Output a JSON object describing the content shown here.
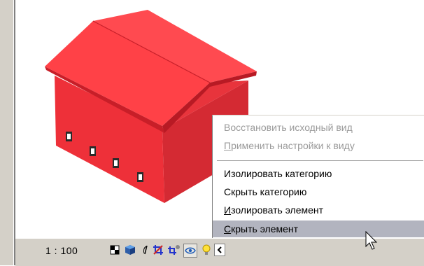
{
  "context_menu": {
    "items": [
      {
        "label": "Восстановить исходный вид",
        "disabled": true
      },
      {
        "label": "Применить настройки к виду",
        "disabled": true,
        "underline_char": "П"
      },
      {
        "label": "Изолировать категорию",
        "disabled": false
      },
      {
        "label": "Скрыть категорию",
        "disabled": false
      },
      {
        "label": "Изолировать элемент",
        "disabled": false,
        "underline_char": "И"
      },
      {
        "label": "Скрыть элемент",
        "disabled": false,
        "underline_char": "С",
        "selected": true
      }
    ]
  },
  "statusbar": {
    "scale": "1 : 100",
    "icons": [
      "detail-level-icon",
      "visual-style-icon",
      "sun-path-icon",
      "crop-view-icon",
      "show-crop-icon",
      "temporary-hide-isolate-icon",
      "reveal-hidden-icon",
      "scroll-left-icon"
    ]
  },
  "model": {
    "wall_color": "#f2323c",
    "roof_color": "#ff3f46"
  }
}
